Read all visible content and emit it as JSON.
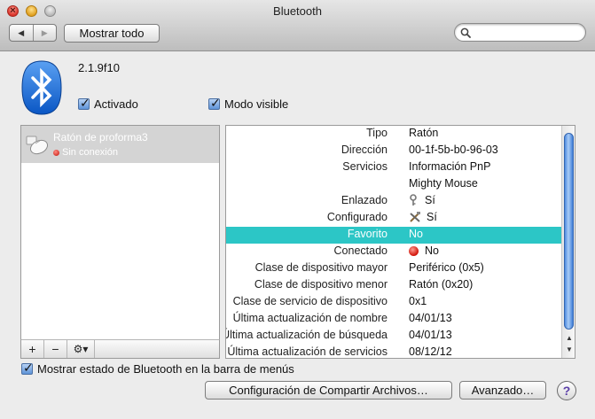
{
  "window": {
    "title": "Bluetooth"
  },
  "toolbar": {
    "back_glyph": "◀",
    "forward_glyph": "▶",
    "show_all_label": "Mostrar todo",
    "search_placeholder": ""
  },
  "bluetooth": {
    "version": "2.1.9f10",
    "enabled_label": "Activado",
    "discoverable_label": "Modo visible",
    "enabled": true,
    "discoverable": true
  },
  "devices": [
    {
      "name": "Ratón de proforma3",
      "status": "Sin conexión",
      "icon": "mouse-icon"
    }
  ],
  "list_controls": {
    "add": "+",
    "remove": "−",
    "gear": "⚙▾"
  },
  "properties": [
    {
      "label": "Tipo",
      "value": "Ratón"
    },
    {
      "label": "Dirección",
      "value": "00-1f-5b-b0-96-03"
    },
    {
      "label": "Servicios",
      "value": "Información PnP"
    },
    {
      "label": "",
      "value": "Mighty Mouse"
    },
    {
      "label": "Enlazado",
      "value": "Sí",
      "icon": "key-icon"
    },
    {
      "label": "Configurado",
      "value": "Sí",
      "icon": "tools-icon"
    },
    {
      "label": "Favorito",
      "value": "No",
      "selected": true
    },
    {
      "label": "Conectado",
      "value": "No",
      "icon": "red-dot-icon"
    },
    {
      "label": "Clase de dispositivo mayor",
      "value": "Periférico (0x5)"
    },
    {
      "label": "Clase de dispositivo menor",
      "value": "Ratón (0x20)"
    },
    {
      "label": "Clase de servicio de dispositivo",
      "value": "0x1"
    },
    {
      "label": "Última actualización de nombre",
      "value": "04/01/13"
    },
    {
      "label": "Última actualización de búsqueda",
      "value": "04/01/13"
    },
    {
      "label": "Última actualización de servicios",
      "value": "08/12/12"
    }
  ],
  "footer": {
    "menubar_label": "Mostrar estado de Bluetooth en la barra de menús",
    "menubar_checked": true,
    "share_button": "Configuración de Compartir Archivos…",
    "advanced_button": "Avanzado…",
    "help_glyph": "?"
  },
  "colors": {
    "selection": "#2cc6c6",
    "bluetooth_blue": "#1a6fdc"
  }
}
